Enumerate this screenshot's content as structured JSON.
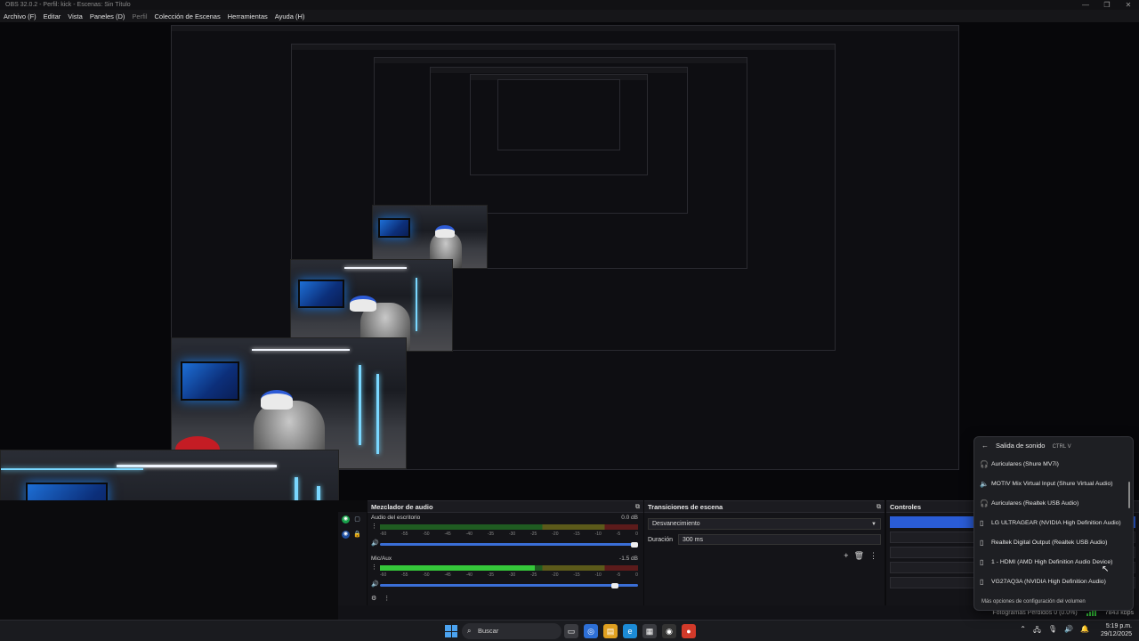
{
  "window": {
    "title": "OBS 32.0.2 - Perfil: kick - Escenas: Sin Título",
    "minimize": "—",
    "maximize": "❐",
    "close": "✕"
  },
  "menubar": {
    "file": "Archivo (F)",
    "edit": "Editar",
    "view": "Vista",
    "docks": "Paneles (D)",
    "profile": "Perfil",
    "scene_collection": "Colección de Escenas",
    "tools": "Herramientas",
    "help": "Ayuda (H)"
  },
  "mixer": {
    "title": "Mezclador de audio",
    "scale": [
      "-60",
      "-55",
      "-50",
      "-45",
      "-40",
      "-35",
      "-30",
      "-25",
      "-20",
      "-15",
      "-10",
      "-5",
      "0"
    ],
    "channels": [
      {
        "name": "Audio del escritorio",
        "db": "0.0 dB",
        "level": 0.0
      },
      {
        "name": "Mic/Aux",
        "db": "-1.5 dB",
        "level": 0.6
      }
    ]
  },
  "transitions": {
    "title": "Transiciones de escena",
    "selected": "Desvanecimiento",
    "duration_label": "Duración",
    "duration_value": "300 ms"
  },
  "controls": {
    "title": "Controles"
  },
  "status": {
    "dropped": "Fotogramas Perdidos 0 (0.0%)",
    "bitrate": "7843 kbps"
  },
  "taskbar": {
    "search_placeholder": "Buscar",
    "time": "5:19 p.m.",
    "date": "29/12/2025"
  },
  "sound_flyout": {
    "title": "Salida de sonido",
    "shortcut": "CTRL V",
    "devices": [
      {
        "label": "Auriculares (Shure MV7i)",
        "icon": "headphones-icon"
      },
      {
        "label": "MOTIV Mix Virtual Input (Shure Virtual Audio)",
        "icon": "speaker-icon"
      },
      {
        "label": "Auriculares (Realtek USB Audio)",
        "icon": "headphones-icon"
      },
      {
        "label": "LG ULTRAGEAR (NVIDIA High Definition Audio)",
        "icon": "monitor-speaker-icon"
      },
      {
        "label": "Realtek Digital Output (Realtek USB Audio)",
        "icon": "monitor-speaker-icon"
      },
      {
        "label": "1 - HDMI (AMD High Definition Audio Device)",
        "icon": "monitor-speaker-icon"
      },
      {
        "label": "VG27AQ3A (NVIDIA High Definition Audio)",
        "icon": "monitor-speaker-icon"
      }
    ],
    "more_options": "Más opciones de configuración del volumen"
  }
}
